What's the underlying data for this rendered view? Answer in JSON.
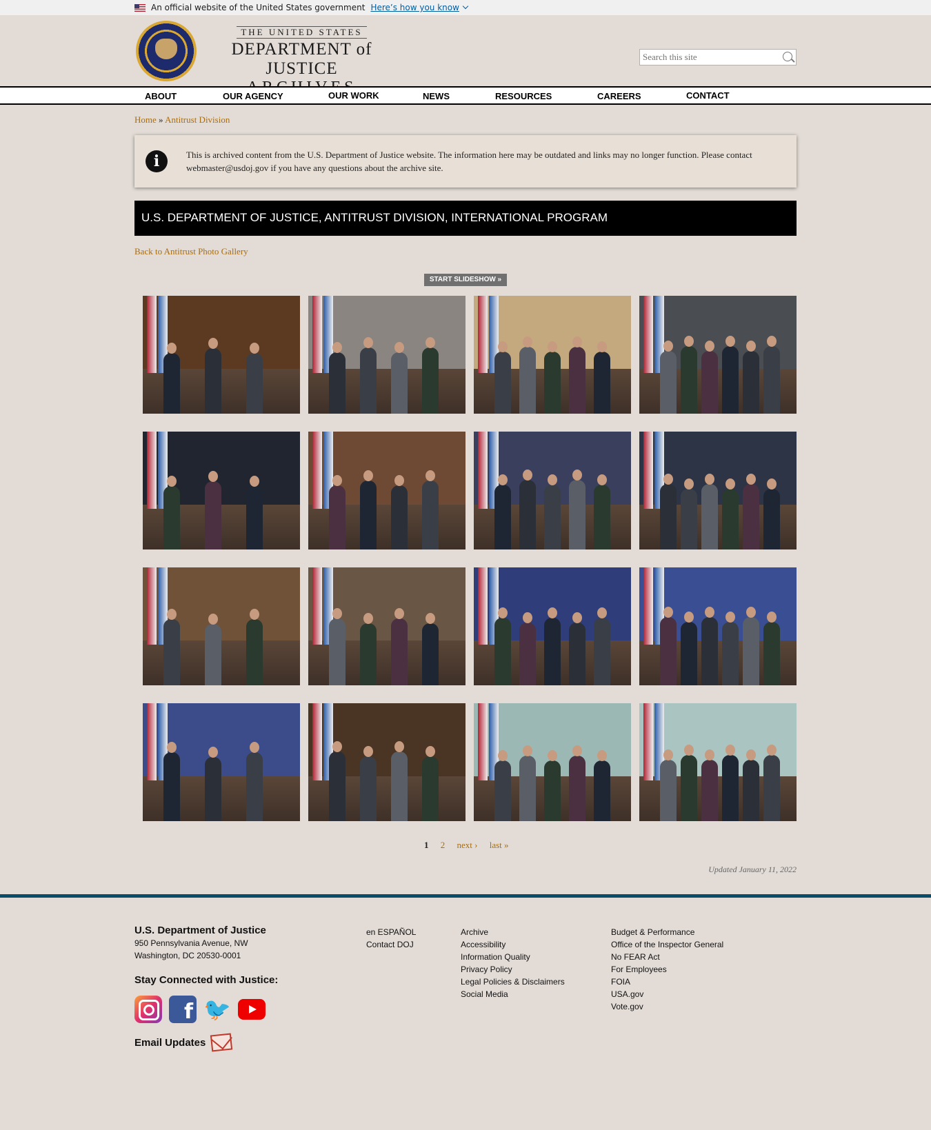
{
  "gov_banner": {
    "text": "An official website of the United States government",
    "link": "Here’s how you know"
  },
  "header": {
    "logo_line1": "THE UNITED STATES",
    "logo_line2": "DEPARTMENT of JUSTICE",
    "logo_line3": "ARCHIVES",
    "search_placeholder": "Search this site"
  },
  "nav": [
    "ABOUT",
    "OUR AGENCY",
    "OUR WORK",
    "NEWS",
    "RESOURCES",
    "CAREERS",
    "CONTACT"
  ],
  "breadcrumb": {
    "home": "Home",
    "sep": "»",
    "current": "Antitrust Division"
  },
  "notice": "This is archived content from the U.S. Department of Justice website. The information here may be outdated and links may no longer function. Please contact webmaster@usdoj.gov if you have any questions about the archive site.",
  "page_title": "U.S. DEPARTMENT OF JUSTICE, ANTITRUST DIVISION, INTERNATIONAL PROGRAM",
  "back_link": "Back to Antitrust Photo Gallery",
  "slideshow_button": "START SLIDESHOW »",
  "gallery": {
    "photo_count": 16,
    "accent_colors": [
      "#5c3a22",
      "#8a8580",
      "#c4a97f",
      "#4a4d52",
      "#202530",
      "#6e4a35",
      "#3b3f5e",
      "#2c3446",
      "#705238",
      "#6a5645",
      "#2f3e7a",
      "#3a4f93",
      "#3c4c8a",
      "#4a3424",
      "#9bb8b4",
      "#a9c4c1"
    ]
  },
  "pager": {
    "current": "1",
    "page2": "2",
    "next": "next ›",
    "last": "last »"
  },
  "updated": "Updated January 11, 2022",
  "footer": {
    "org": "U.S. Department of Justice",
    "addr1": "950 Pennsylvania Avenue, NW",
    "addr2": "Washington, DC 20530-0001",
    "stay_connected": "Stay Connected with Justice:",
    "social_icons": [
      "instagram-icon",
      "facebook-icon",
      "twitter-icon",
      "youtube-icon"
    ],
    "email_updates": "Email Updates",
    "col1": [
      "en ESPAÑOL",
      "Contact DOJ"
    ],
    "col2": [
      "Archive",
      "Accessibility",
      "Information Quality",
      "Privacy Policy",
      "Legal Policies & Disclaimers",
      "Social Media"
    ],
    "col3": [
      "Budget & Performance",
      "Office of the Inspector General",
      "No FEAR Act",
      "For Employees",
      "FOIA",
      "USA.gov",
      "Vote.gov"
    ]
  }
}
